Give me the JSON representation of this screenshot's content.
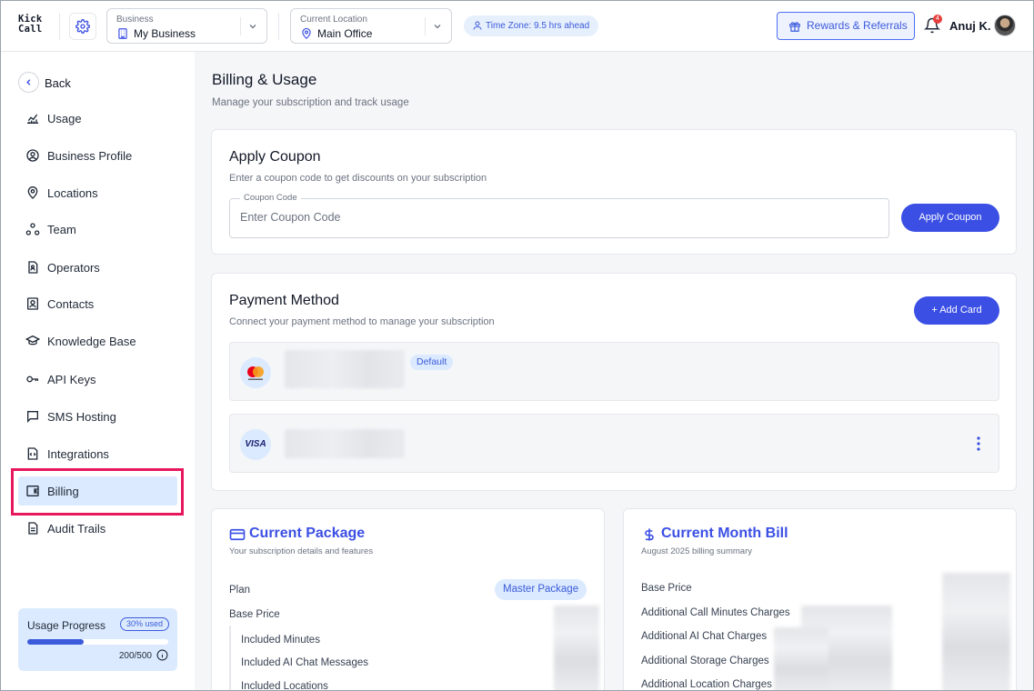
{
  "header": {
    "logo_line1": "Kick",
    "logo_line2": "Call",
    "business": {
      "label": "Business",
      "value": "My Business"
    },
    "location": {
      "label": "Current Location",
      "value": "Main Office"
    },
    "timezone": "Time Zone: 9.5 hrs ahead",
    "rewards_label": "Rewards & Referrals",
    "notification_count": "4",
    "user_name": "Anuj K."
  },
  "sidebar": {
    "back_label": "Back",
    "items": [
      {
        "label": "Usage",
        "icon": "chart-line-icon"
      },
      {
        "label": "Business Profile",
        "icon": "user-circle-icon"
      },
      {
        "label": "Locations",
        "icon": "map-pin-icon"
      },
      {
        "label": "Team",
        "icon": "team-icon"
      },
      {
        "label": "Operators",
        "icon": "operator-icon"
      },
      {
        "label": "Contacts",
        "icon": "contact-card-icon"
      },
      {
        "label": "Knowledge Base",
        "icon": "graduation-cap-icon"
      },
      {
        "label": "API Keys",
        "icon": "key-icon"
      },
      {
        "label": "SMS Hosting",
        "icon": "message-icon"
      },
      {
        "label": "Integrations",
        "icon": "code-file-icon"
      },
      {
        "label": "Billing",
        "icon": "wallet-icon",
        "active": true
      },
      {
        "label": "Audit Trails",
        "icon": "document-icon"
      }
    ],
    "usage": {
      "title": "Usage Progress",
      "badge": "30% used",
      "count": "200/500",
      "percent": 40
    }
  },
  "main": {
    "title": "Billing & Usage",
    "subtitle": "Manage your subscription and track usage",
    "coupon": {
      "title": "Apply Coupon",
      "subtitle": "Enter a coupon code to get discounts on your subscription",
      "field_label": "Coupon Code",
      "placeholder": "Enter Coupon Code",
      "button": "Apply Coupon"
    },
    "payment": {
      "title": "Payment Method",
      "subtitle": "Connect your payment method to manage your subscription",
      "add_button": "+ Add Card",
      "cards": [
        {
          "brand": "mastercard",
          "default_badge": "Default"
        },
        {
          "brand": "VISA"
        }
      ]
    },
    "package": {
      "title": "Current Package",
      "subtitle": "Your subscription details and features",
      "plan_label": "Plan",
      "plan_value": "Master Package",
      "base_price_label": "Base Price",
      "features": [
        "Included Minutes",
        "Included AI Chat Messages",
        "Included Locations"
      ]
    },
    "bill": {
      "title": "Current Month Bill",
      "subtitle": "August 2025 billing summary",
      "rows": [
        "Base Price",
        "Additional Call Minutes Charges",
        "Additional AI Chat Charges",
        "Additional Storage Charges",
        "Additional Location Charges"
      ]
    }
  },
  "colors": {
    "accent": "#3b4fe4",
    "active_bg": "#dbeafe",
    "highlight": "#e8175d",
    "page_bg": "#f5f6f8"
  }
}
